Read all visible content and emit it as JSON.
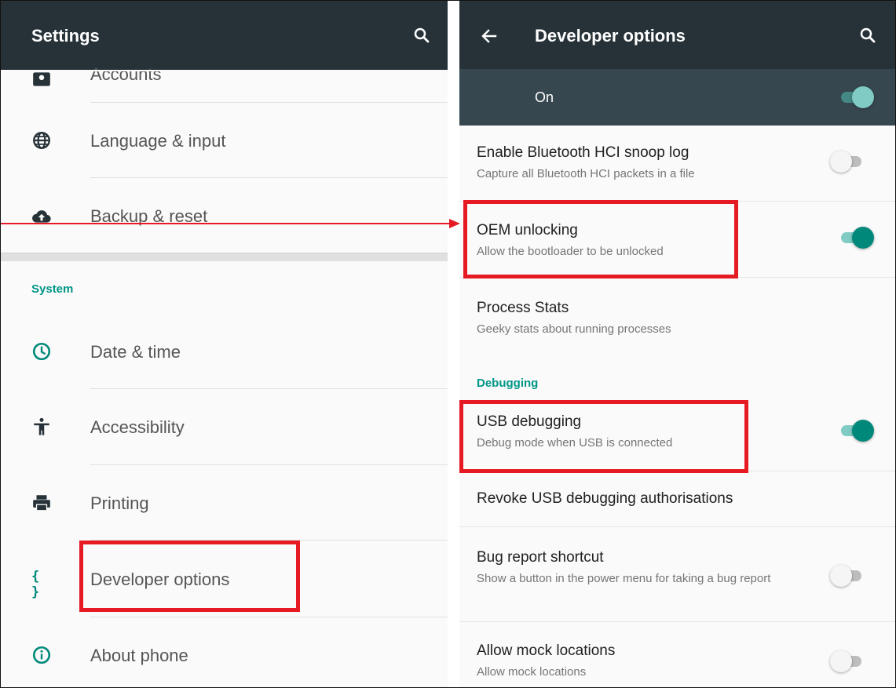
{
  "left": {
    "title": "Settings",
    "items_top": [
      {
        "label": "Accounts",
        "icon": "accounts-icon"
      },
      {
        "label": "Language & input",
        "icon": "globe-icon"
      },
      {
        "label": "Backup & reset",
        "icon": "cloud-upload-icon"
      }
    ],
    "section": "System",
    "items_system": [
      {
        "label": "Date & time",
        "icon": "clock-icon"
      },
      {
        "label": "Accessibility",
        "icon": "accessibility-icon"
      },
      {
        "label": "Printing",
        "icon": "printer-icon"
      },
      {
        "label": "Developer options",
        "icon": "braces-icon",
        "glyph": "{ }"
      },
      {
        "label": "About phone",
        "icon": "info-icon"
      }
    ]
  },
  "right": {
    "title": "Developer options",
    "master": {
      "label": "On",
      "state": true
    },
    "options": [
      {
        "title": "Enable Bluetooth HCI snoop log",
        "subtitle": "Capture all Bluetooth HCI packets in a file",
        "state": false
      },
      {
        "title": "OEM unlocking",
        "subtitle": "Allow the bootloader to be unlocked",
        "state": true
      },
      {
        "title": "Process Stats",
        "subtitle": "Geeky stats about running processes"
      }
    ],
    "section": "Debugging",
    "debug_options": [
      {
        "title": "USB debugging",
        "subtitle": "Debug mode when USB is connected",
        "state": true
      },
      {
        "title": "Revoke USB debugging authorisations"
      },
      {
        "title": "Bug report shortcut",
        "subtitle": "Show a button in the power menu for taking a bug report",
        "state": false
      },
      {
        "title": "Allow mock locations",
        "subtitle": "Allow mock locations",
        "state": false
      }
    ]
  },
  "colors": {
    "appbar": "#263238",
    "master_bar": "#37474f",
    "accent": "#009688",
    "switch_on": "#00897b",
    "highlight": "#e51a23"
  }
}
